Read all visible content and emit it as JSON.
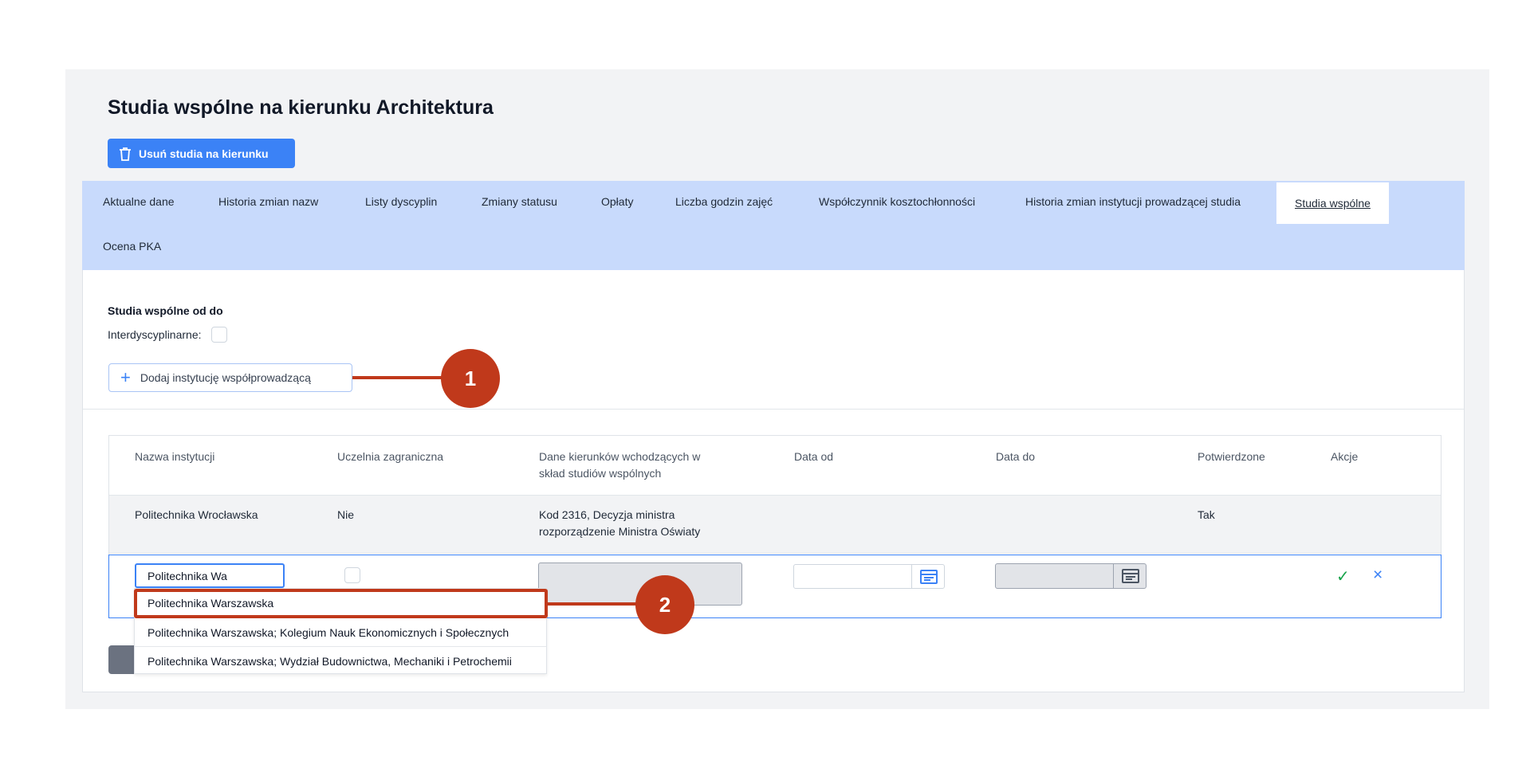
{
  "title": "Studia wspólne na kierunku Architektura",
  "delete_button": "Usuń studia na kierunku",
  "tabs": [
    "Aktualne dane",
    "Historia zmian nazw",
    "Listy dyscyplin",
    "Zmiany statusu",
    "Opłaty",
    "Liczba godzin zajęć",
    "Współczynnik kosztochłonności",
    "Historia zmian instytucji prowadzącej studia",
    "Studia wspólne",
    "Ocena PKA"
  ],
  "active_tab": "Studia wspólne",
  "section": {
    "label": "Studia wspólne od do",
    "interdisciplinary_label": "Interdyscyplinarne:",
    "add_button": "Dodaj instytucję współprowadzącą"
  },
  "table": {
    "headers": {
      "name": "Nazwa instytucji",
      "foreign": "Uczelnia zagraniczna",
      "dane_line1": "Dane kierunków wchodzących w",
      "dane_line2": "skład studiów wspólnych",
      "date_from": "Data od",
      "date_to": "Data do",
      "confirmed": "Potwierdzone",
      "actions": "Akcje"
    },
    "rows": [
      {
        "name": "Politechnika Wrocławska",
        "foreign": "Nie",
        "dane_line1": "Kod 2316, Decyzja ministra",
        "dane_line2": "rozporządzenie Ministra Oświaty",
        "confirmed": "Tak"
      }
    ],
    "edit_row": {
      "name_value": "Politechnika Wa"
    }
  },
  "dropdown_options": [
    "Politechnika Warszawska",
    "Politechnika Warszawska; Kolegium Nauk Ekonomicznych i Społecznych",
    "Politechnika Warszawska; Wydział Budownictwa, Mechaniki i Petrochemii"
  ],
  "callouts": [
    "1",
    "2"
  ],
  "colors": {
    "primary": "#3b82f6",
    "tab_bar": "#c8dafc",
    "annotation": "#c0391b",
    "confirm": "#16a34a"
  },
  "icons": {
    "delete": "trash-icon",
    "add": "plus-icon",
    "calendar": "calendar-icon",
    "confirm": "check-icon",
    "cancel": "close-icon"
  }
}
